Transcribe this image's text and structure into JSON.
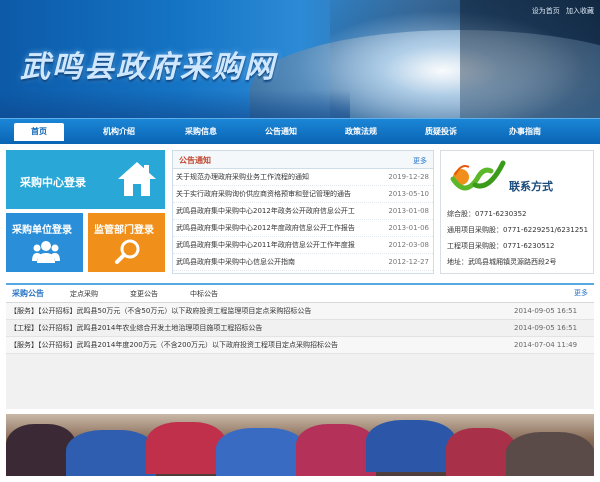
{
  "header": {
    "site_title": "武鸣县政府采购网",
    "top_links": [
      "设为首页",
      "加入收藏"
    ]
  },
  "nav": {
    "items": [
      {
        "label": "首页",
        "active": true
      },
      {
        "label": "机构介绍"
      },
      {
        "label": "采购信息"
      },
      {
        "label": "公告通知"
      },
      {
        "label": "政策法规"
      },
      {
        "label": "质疑投诉"
      },
      {
        "label": "办事指南"
      }
    ]
  },
  "tiles": {
    "center_login": "采购中心登录",
    "unit_login": "采购单位登录",
    "dept_login": "监管部门登录"
  },
  "notice": {
    "title": "公告通知",
    "more": "更多",
    "rows": [
      {
        "title": "关于规范办理政府采购业务工作流程的通知",
        "date": "2019-12-28"
      },
      {
        "title": "关于实行政府采购询价供应商资格预审和登记管理的通告",
        "date": "2013-05-10"
      },
      {
        "title": "武鸣县政府集中采购中心2012年政务公开政府信息公开工",
        "date": "2013-01-08"
      },
      {
        "title": "武鸣县政府集中采购中心2012年度政府信息公开工作报告",
        "date": "2013-01-06"
      },
      {
        "title": "武鸣县政府集中采购中心2011年政府信息公开工作年度报",
        "date": "2012-03-08"
      },
      {
        "title": "武鸣县政府集中采购中心信息公开指南",
        "date": "2012-12-27"
      }
    ]
  },
  "contact": {
    "title": "联系方式",
    "lines": [
      "综合股：0771-6230352",
      "通用项目采购股：0771-6229251/6231251",
      "工程项目采购股：0771-6230512",
      "地址：武鸣县城厢镇灵源路西段2号"
    ]
  },
  "procurement": {
    "tabs": [
      "采购公告",
      "定点采购",
      "变更公告",
      "中标公告"
    ],
    "more": "更多",
    "rows": [
      {
        "title": "【服务】【公开招标】武鸣县50万元（不含50万元）以下政府投资工程监理项目定点采购招标公告",
        "date": "2014-09-05 16:51"
      },
      {
        "title": "【工程】【公开招标】武鸣县2014年农业综合开发土地治理项目施项工程招标公告",
        "date": "2014-09-05 16:51"
      },
      {
        "title": "【服务】【公开招标】武鸣县2014年度200万元（不含200万元）以下政府投资工程项目定点采购招标公告",
        "date": "2014-07-04 11:49"
      }
    ]
  },
  "colors": {
    "nav_blue": "#0b64b4",
    "tile_blue": "#29a8d8",
    "tile_orange": "#f0901a",
    "notice_title_red": "#c0472f",
    "link_blue": "#2a76c6"
  }
}
